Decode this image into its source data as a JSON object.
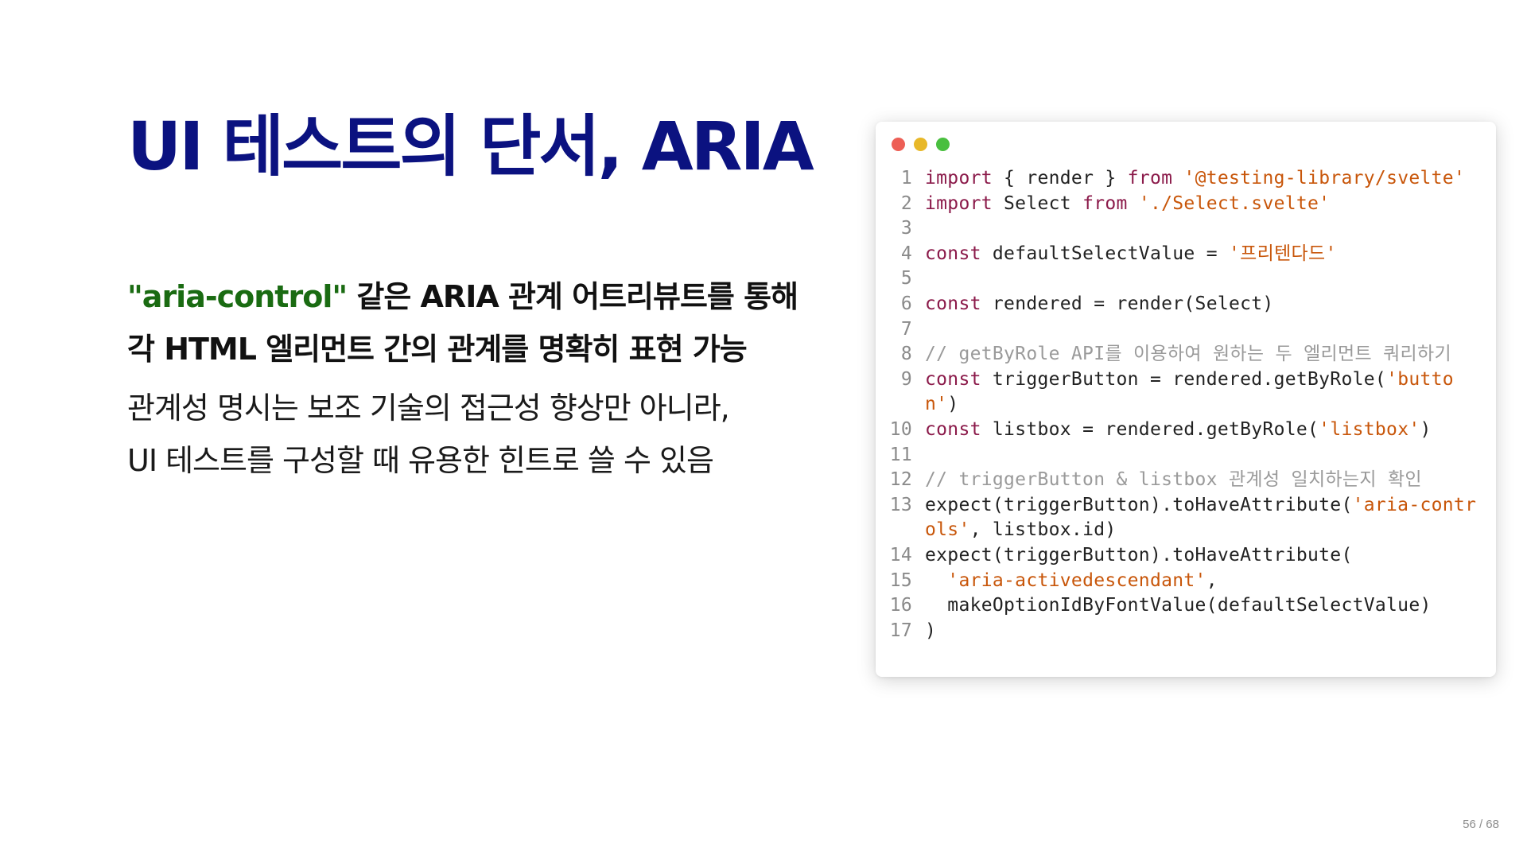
{
  "slide": {
    "title": "UI 테스트의 단서, ARIA",
    "lead": {
      "accent": "\"aria-control\"",
      "line1_rest": " 같은 ARIA 관계 어트리뷰트를 통해",
      "line2": "각 HTML 엘리먼트 간의 관계를 명확히 표현 가능"
    },
    "sub": {
      "line1": "관계성 명시는 보조 기술의 접근성 향상만 아니라,",
      "line2": "UI 테스트를 구성할 때 유용한 힌트로 쓸 수 있음"
    },
    "page": "56 / 68"
  },
  "code": {
    "dots": [
      "#ed5f56",
      "#e8b829",
      "#49bf3f"
    ],
    "colors": {
      "keyword": "#8b1a4a",
      "string": "#c8560a",
      "comment": "#9a9a9a"
    },
    "lines": [
      {
        "n": "1",
        "tokens": [
          [
            "kw",
            "import"
          ],
          [
            "p",
            " { render } "
          ],
          [
            "kw",
            "from"
          ],
          [
            "p",
            " "
          ],
          [
            "str",
            "'@testing-library/svelte'"
          ]
        ]
      },
      {
        "n": "2",
        "tokens": [
          [
            "kw",
            "import"
          ],
          [
            "p",
            " Select "
          ],
          [
            "kw",
            "from"
          ],
          [
            "p",
            " "
          ],
          [
            "str",
            "'./Select.svelte'"
          ]
        ]
      },
      {
        "n": "3",
        "tokens": []
      },
      {
        "n": "4",
        "tokens": [
          [
            "kw",
            "const"
          ],
          [
            "p",
            " defaultSelectValue = "
          ],
          [
            "str",
            "'프리텐다드'"
          ]
        ]
      },
      {
        "n": "5",
        "tokens": []
      },
      {
        "n": "6",
        "tokens": [
          [
            "kw",
            "const"
          ],
          [
            "p",
            " rendered = render(Select)"
          ]
        ]
      },
      {
        "n": "7",
        "tokens": []
      },
      {
        "n": "8",
        "tokens": [
          [
            "cmt",
            "// getByRole API를 이용하여 원하는 두 엘리먼트 쿼리하기"
          ]
        ]
      },
      {
        "n": "9",
        "tokens": [
          [
            "kw",
            "const"
          ],
          [
            "p",
            " triggerButton = rendered.getByRole("
          ],
          [
            "str",
            "'button'"
          ],
          [
            "p",
            ")"
          ]
        ]
      },
      {
        "n": "10",
        "tokens": [
          [
            "kw",
            "const"
          ],
          [
            "p",
            " listbox = rendered.getByRole("
          ],
          [
            "str",
            "'listbox'"
          ],
          [
            "p",
            ")"
          ]
        ]
      },
      {
        "n": "11",
        "tokens": []
      },
      {
        "n": "12",
        "tokens": [
          [
            "cmt",
            "// triggerButton & listbox 관계성 일치하는지 확인"
          ]
        ]
      },
      {
        "n": "13",
        "tokens": [
          [
            "p",
            "expect(triggerButton).toHaveAttribute("
          ],
          [
            "str",
            "'aria-controls'"
          ],
          [
            "p",
            ", listbox.id)"
          ]
        ]
      },
      {
        "n": "14",
        "tokens": [
          [
            "p",
            "expect(triggerButton).toHaveAttribute("
          ]
        ]
      },
      {
        "n": "15",
        "tokens": [
          [
            "p",
            "  "
          ],
          [
            "str",
            "'aria-activedescendant'"
          ],
          [
            "p",
            ","
          ]
        ]
      },
      {
        "n": "16",
        "tokens": [
          [
            "p",
            "  makeOptionIdByFontValue(defaultSelectValue)"
          ]
        ]
      },
      {
        "n": "17",
        "tokens": [
          [
            "p",
            ")"
          ]
        ]
      }
    ]
  }
}
